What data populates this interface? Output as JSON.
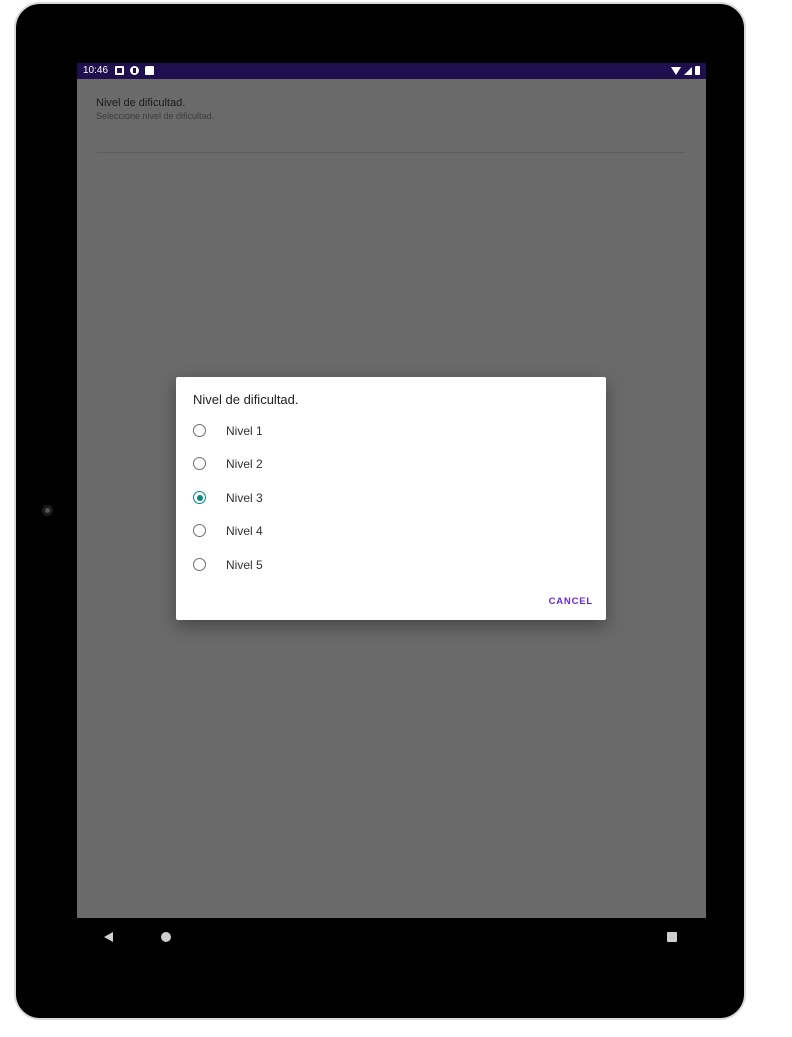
{
  "status_bar": {
    "time": "10:46",
    "left_icons": [
      "a-box-icon",
      "circle-app-icon",
      "sd-card-icon"
    ],
    "right_icons": [
      "wifi-icon",
      "signal-icon",
      "battery-icon"
    ],
    "color": "#1f0f4f"
  },
  "preference": {
    "title": "Nivel de dificultad.",
    "summary": "Seleccione nivel de dificultad."
  },
  "dialog": {
    "title": "Nivel de dificultad.",
    "options": [
      {
        "label": "Nivel 1",
        "selected": false
      },
      {
        "label": "Nivel 2",
        "selected": false
      },
      {
        "label": "Nivel 3",
        "selected": true
      },
      {
        "label": "Nivel 4",
        "selected": false
      },
      {
        "label": "Nivel 5",
        "selected": false
      }
    ],
    "cancel_label": "CANCEL",
    "accent_color": "#00897b",
    "button_color": "#6a2bd1"
  },
  "nav_bar": {
    "buttons": [
      "back-icon",
      "home-icon",
      "recents-icon"
    ]
  }
}
